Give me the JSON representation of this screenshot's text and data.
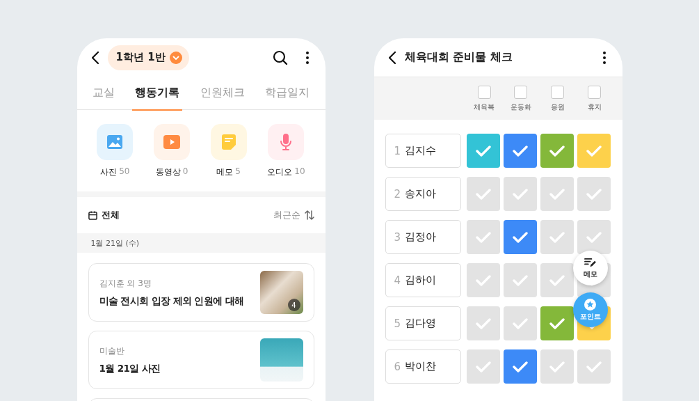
{
  "left_screen": {
    "class_selector": {
      "label": "1학년 1반"
    },
    "tabs": [
      {
        "label": "교실",
        "selected": false
      },
      {
        "label": "행동기록",
        "selected": true
      },
      {
        "label": "인원체크",
        "selected": false
      },
      {
        "label": "학급일지",
        "selected": false
      }
    ],
    "media": [
      {
        "kind": "photo",
        "label": "사진",
        "count": "50"
      },
      {
        "kind": "video",
        "label": "동영상",
        "count": "0"
      },
      {
        "kind": "memo",
        "label": "메모",
        "count": "5"
      },
      {
        "kind": "audio",
        "label": "오디오",
        "count": "10"
      }
    ],
    "filter": {
      "label": "전체",
      "sort": "최근순"
    },
    "date_header": "1월 21일 (수)",
    "cards": [
      {
        "meta": "김지훈 외 3명",
        "title": "미술 전시회 입장 제외 인원에 대해",
        "photo_count": "4"
      },
      {
        "meta": "미술반",
        "title": "1월 21일 사진"
      }
    ]
  },
  "right_screen": {
    "title": "체육대회 준비물 체크",
    "columns": [
      {
        "label": "체육복",
        "checked": false,
        "color": "#33c3d6"
      },
      {
        "label": "운동화",
        "checked": false,
        "color": "#3d8af7"
      },
      {
        "label": "응원",
        "checked": false,
        "color": "#84b83a"
      },
      {
        "label": "휴지",
        "checked": false,
        "color": "#fdd14b"
      }
    ],
    "rows": [
      {
        "number": "1",
        "name": "김지수",
        "checks": [
          true,
          true,
          true,
          true
        ]
      },
      {
        "number": "2",
        "name": "송지아",
        "checks": [
          false,
          false,
          false,
          false
        ]
      },
      {
        "number": "3",
        "name": "김정아",
        "checks": [
          false,
          true,
          false,
          false
        ]
      },
      {
        "number": "4",
        "name": "김하이",
        "checks": [
          false,
          false,
          false,
          false
        ]
      },
      {
        "number": "5",
        "name": "김다영",
        "checks": [
          false,
          false,
          true,
          true
        ]
      },
      {
        "number": "6",
        "name": "박이찬",
        "checks": [
          false,
          true,
          false,
          false
        ]
      }
    ],
    "fab": [
      {
        "kind": "memo",
        "label": "메모"
      },
      {
        "kind": "point",
        "label": "포인트"
      }
    ]
  }
}
